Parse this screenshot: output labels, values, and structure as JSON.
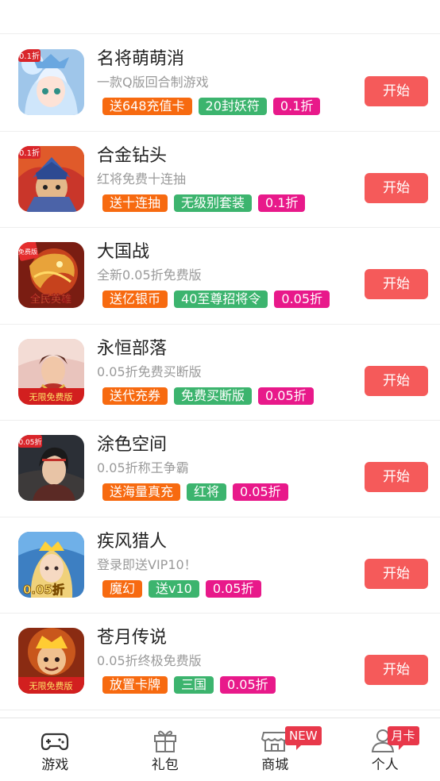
{
  "games": [
    {
      "name": "名将萌萌消",
      "desc": "一款Q版回合制游戏",
      "tags": [
        {
          "text": "送648充值卡",
          "color": "orange"
        },
        {
          "text": "20封妖符",
          "color": "green"
        },
        {
          "text": "0.1折",
          "color": "pink"
        }
      ],
      "button": "开始",
      "icon": "anime-girl-icon",
      "icon_corner": "0.1折"
    },
    {
      "name": "合金钻头",
      "desc": "红将免费十连抽",
      "tags": [
        {
          "text": "送十连抽",
          "color": "orange"
        },
        {
          "text": "无级别套装",
          "color": "green"
        },
        {
          "text": "0.1折",
          "color": "pink"
        }
      ],
      "button": "开始",
      "icon": "warrior-icon",
      "icon_corner": "0.1折"
    },
    {
      "name": "大国战",
      "desc": "全新0.05折免费版",
      "tags": [
        {
          "text": "送亿银币",
          "color": "orange"
        },
        {
          "text": "40至尊招将令",
          "color": "green"
        },
        {
          "text": "0.05折",
          "color": "pink"
        }
      ],
      "button": "开始",
      "icon": "dragon-icon",
      "icon_corner": "免费版",
      "icon_caption": "全民英雄"
    },
    {
      "name": "永恒部落",
      "desc": "0.05折免费买断版",
      "tags": [
        {
          "text": "送代充券",
          "color": "orange"
        },
        {
          "text": "免费买断版",
          "color": "green"
        },
        {
          "text": "0.05折",
          "color": "pink"
        }
      ],
      "button": "开始",
      "icon": "warlord-icon",
      "icon_caption": "无限免费版"
    },
    {
      "name": "涂色空间",
      "desc": "0.05折称王争霸",
      "tags": [
        {
          "text": "送海量真充",
          "color": "orange"
        },
        {
          "text": "红将",
          "color": "green"
        },
        {
          "text": "0.05折",
          "color": "pink"
        }
      ],
      "button": "开始",
      "icon": "swordsman-icon",
      "icon_corner": "0.05折"
    },
    {
      "name": "疾风猎人",
      "desc": "登录即送VIP10！",
      "tags": [
        {
          "text": "魔幻",
          "color": "orange"
        },
        {
          "text": "送v10",
          "color": "green"
        },
        {
          "text": "0.05折",
          "color": "pink"
        }
      ],
      "button": "开始",
      "icon": "queen-icon",
      "icon_caption": "0.05折"
    },
    {
      "name": "苍月传说",
      "desc": "0.05折终极免费版",
      "tags": [
        {
          "text": "放置卡牌",
          "color": "orange"
        },
        {
          "text": "三国",
          "color": "green"
        },
        {
          "text": "0.05折",
          "color": "pink"
        }
      ],
      "button": "开始",
      "icon": "king-icon",
      "icon_caption": "无限免费版"
    }
  ],
  "tabbar": {
    "tabs": [
      {
        "label": "游戏",
        "icon": "gamepad-icon"
      },
      {
        "label": "礼包",
        "icon": "gift-icon"
      },
      {
        "label": "商城",
        "icon": "store-icon",
        "badge": "NEW"
      },
      {
        "label": "个人",
        "icon": "person-icon",
        "badge": "月卡"
      }
    ]
  },
  "colors": {
    "orange": "#f76a10",
    "green": "#3cb46e",
    "pink": "#e8198a",
    "button": "#f55a5a",
    "badge": "#e8384a"
  }
}
